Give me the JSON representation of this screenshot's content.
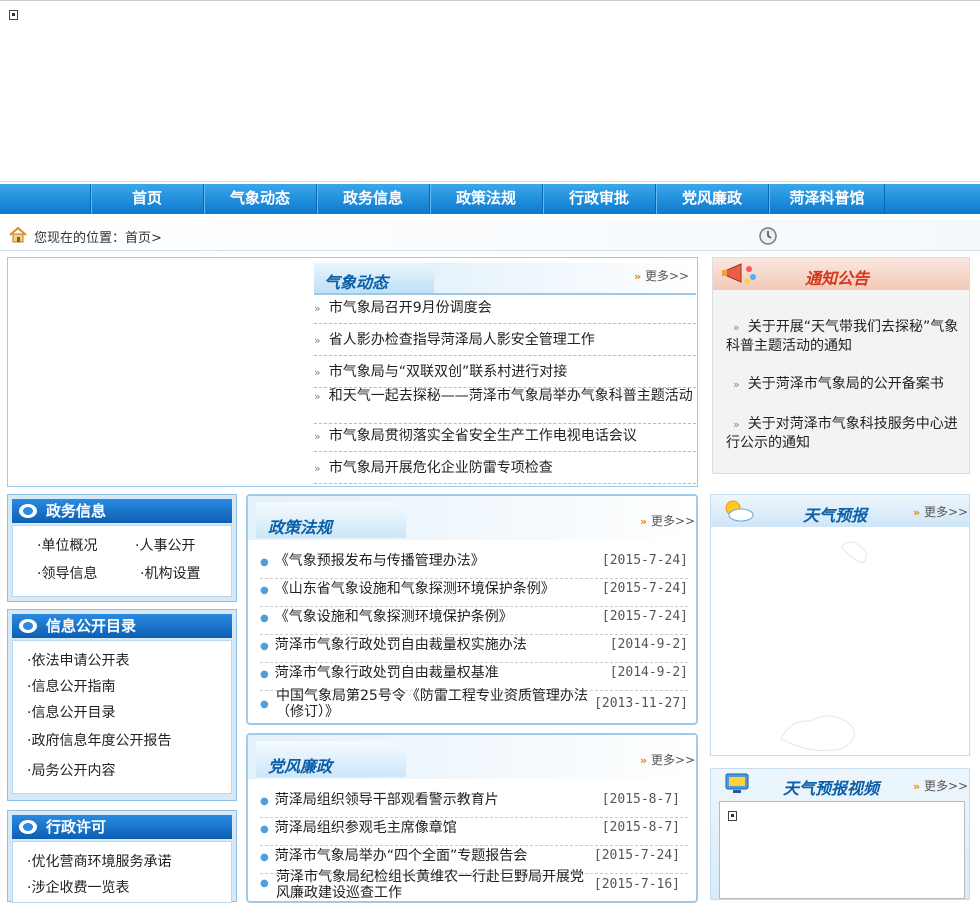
{
  "nav": [
    "首页",
    "气象动态",
    "政务信息",
    "政策法规",
    "行政审批",
    "党风廉政",
    "菏泽科普馆"
  ],
  "breadcrumb": {
    "label": "您现在的位置：首页>"
  },
  "weather_news": {
    "title": "气象动态",
    "more": "更多>>",
    "items": [
      "市气象局召开9月份调度会",
      "省人影办检查指导菏泽局人影安全管理工作",
      "市气象局与“双联双创”联系村进行对接",
      "和天气一起去探秘——菏泽市气象局举办气象科普主题活动",
      "市气象局贯彻落实全省安全生产工作电视电话会议",
      "市气象局开展危化企业防雷专项检查"
    ]
  },
  "notice": {
    "title": "通知公告",
    "items": [
      "关于开展“天气带我们去探秘”气象科普主题活动的通知",
      "关于菏泽市气象局的公开备案书",
      "关于对菏泽市气象科技服务中心进行公示的通知"
    ]
  },
  "gov_info": {
    "title": "政务信息",
    "items": [
      "单位概况",
      "人事公开",
      "领导信息",
      "机构设置"
    ]
  },
  "open_catalog": {
    "title": "信息公开目录",
    "items": [
      "依法申请公开表",
      "信息公开指南",
      "信息公开目录",
      "政府信息年度公开报告",
      "局务公开内容"
    ]
  },
  "admin_permit": {
    "title": "行政许可",
    "items": [
      "优化营商环境服务承诺",
      "涉企收费一览表"
    ]
  },
  "policy": {
    "title": "政策法规",
    "more": "更多>>",
    "rows": [
      {
        "text": "《气象预报发布与传播管理办法》",
        "date": "[2015-7-24]"
      },
      {
        "text": "《山东省气象设施和气象探测环境保护条例》",
        "date": "[2015-7-24]"
      },
      {
        "text": "《气象设施和气象探测环境保护条例》",
        "date": "[2015-7-24]"
      },
      {
        "text": "菏泽市气象行政处罚自由裁量权实施办法",
        "date": "[2014-9-2]"
      },
      {
        "text": "菏泽市气象行政处罚自由裁量权基准",
        "date": "[2014-9-2]"
      },
      {
        "text": "中国气象局第25号令《防雷工程专业资质管理办法（修订）》",
        "date": "[2013-11-27]"
      }
    ]
  },
  "party": {
    "title": "党风廉政",
    "more": "更多>>",
    "rows": [
      {
        "text": "菏泽局组织领导干部观看警示教育片",
        "date": "[2015-8-7]"
      },
      {
        "text": "菏泽局组织参观毛主席像章馆",
        "date": "[2015-8-7]"
      },
      {
        "text": "菏泽市气象局举办“四个全面”专题报告会",
        "date": "[2015-7-24]"
      },
      {
        "text": "菏泽市气象局纪检组长黄维农一行赴巨野局开展党风廉政建设巡查工作",
        "date": "[2015-7-16]"
      }
    ]
  },
  "forecast": {
    "title": "天气预报",
    "more": "更多>>"
  },
  "forecast_video": {
    "title": "天气预报视频",
    "more": "更多>>"
  }
}
